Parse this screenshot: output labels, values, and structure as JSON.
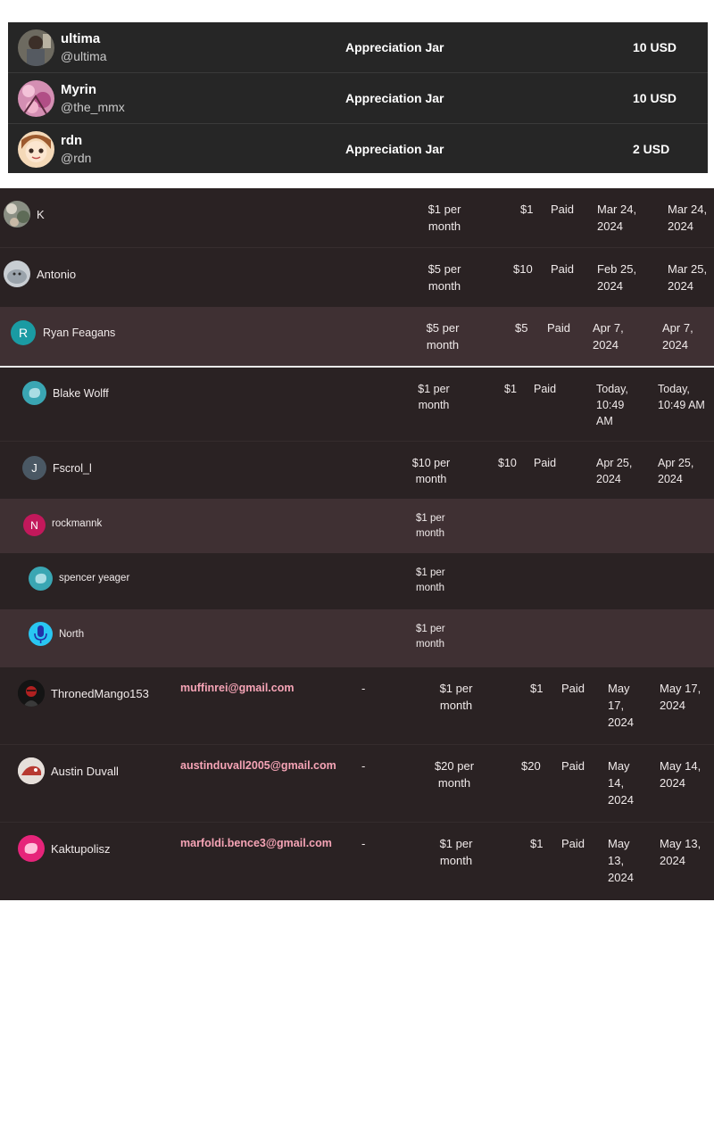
{
  "section1": {
    "rows": [
      {
        "name": "ultima",
        "handle": "@ultima",
        "tier": "Appreciation Jar",
        "amount": "10 USD",
        "avatar": "photo-avatar"
      },
      {
        "name": "Myrin",
        "handle": "@the_mmx",
        "tier": "Appreciation Jar",
        "amount": "10 USD",
        "avatar": "blossom-avatar"
      },
      {
        "name": "rdn",
        "handle": "@rdn",
        "tier": "Appreciation Jar",
        "amount": "2 USD",
        "avatar": "anime-avatar"
      }
    ]
  },
  "section2": {
    "rows": [
      {
        "name": "K",
        "price": "$1 per month",
        "amount": "$1",
        "status": "Paid",
        "date1": "Mar 24, 2024",
        "date2": "Mar 24, 2024"
      },
      {
        "name": "Antonio",
        "price": "$5 per month",
        "amount": "$10",
        "status": "Paid",
        "date1": "Feb 25, 2024",
        "date2": "Mar 25, 2024"
      },
      {
        "name": "Ryan Feagans",
        "avatar_letter": "R",
        "price": "$5 per month",
        "amount": "$5",
        "status": "Paid",
        "date1": "Apr 7, 2024",
        "date2": "Apr 7, 2024"
      }
    ]
  },
  "section3": {
    "rows": [
      {
        "name": "Blake Wolff",
        "price": "$1 per month",
        "amount": "$1",
        "status": "Paid",
        "date1": "Today, 10:49 AM",
        "date2": "Today, 10:49 AM"
      },
      {
        "name": "Fscrol_l",
        "avatar_letter": "J",
        "price": "$10 per month",
        "amount": "$10",
        "status": "Paid",
        "date1": "Apr 25, 2024",
        "date2": "Apr 25, 2024"
      },
      {
        "name": "rockmannk",
        "avatar_letter": "N",
        "price": "$1 per month"
      },
      {
        "name": "spencer yeager",
        "price": "$1 per month"
      },
      {
        "name": "North",
        "price": "$1 per month"
      }
    ]
  },
  "section4": {
    "rows": [
      {
        "name": "ThronedMango153",
        "email": "muffinrei@gmail.com",
        "dash": "-",
        "price": "$1 per month",
        "amount": "$1",
        "status": "Paid",
        "date1": "May 17, 2024",
        "date2": "May 17, 2024"
      },
      {
        "name": "Austin Duvall",
        "email": "austinduvall2005@gmail.com",
        "dash": "-",
        "price": "$20 per month",
        "amount": "$20",
        "status": "Paid",
        "date1": "May 14, 2024",
        "date2": "May 14, 2024"
      },
      {
        "name": "Kaktupolisz",
        "email": "marfoldi.bence3@gmail.com",
        "dash": "-",
        "price": "$1 per month",
        "amount": "$1",
        "status": "Paid",
        "date1": "May 13, 2024",
        "date2": "May 13, 2024"
      }
    ]
  },
  "colors": {
    "section1_bg": "#262626",
    "table_bg": "#2a2223",
    "highlight_row": "#3f3033",
    "email_pink": "#f6a4b6",
    "teal_avatar": "#1a9ba3",
    "slate_avatar": "#4a5864",
    "magenta_avatar": "#c2185b",
    "hot_pink_avatar": "#e6247a"
  }
}
